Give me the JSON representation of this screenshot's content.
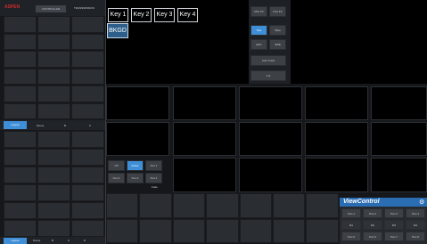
{
  "colors": {
    "accent": "#3f8fd8",
    "logo": "#cc2b2b",
    "panel": "#2a2d31",
    "monitor": "#000000"
  },
  "top_bar": {
    "logo_text": "ASPEN",
    "tab_label": "CONTROLLER",
    "sub_label": "TRANSMISSION"
  },
  "key_tabs": [
    "Key 1",
    "Key 2",
    "Key 3",
    "Key 4"
  ],
  "bkgd_label": "BKGD",
  "transition_panel": {
    "row1": [
      "MIC FX",
      "FX2 FX"
    ],
    "row2": [
      "Sca",
      "Wipe"
    ],
    "row3": [
      "Effct",
      "WPE"
    ],
    "auto_label": "Auto Track",
    "cut_label": "Cut"
  },
  "left_tabs_mid": [
    "Layout",
    "Scene",
    "B",
    "C"
  ],
  "left_tabs_bottom": [
    "Layout",
    "Scene",
    "B",
    "C",
    "D"
  ],
  "small_buttons": {
    "row1": [
      "Off",
      "Active",
      "Pos 1"
    ],
    "row2": [
      "Pos 2",
      "Pos 3",
      "Pos 4"
    ],
    "label": "Fade"
  },
  "view_control": {
    "title": "ViewControl",
    "row1": [
      "Pan 1",
      "Pan 2",
      "Pan 3",
      "Pan 4"
    ],
    "row2": [
      "M1",
      "M2",
      "M3",
      "M4"
    ],
    "row3": [
      "Pan 5",
      "Pan 6",
      "Pan 7",
      "Pan 8"
    ]
  }
}
